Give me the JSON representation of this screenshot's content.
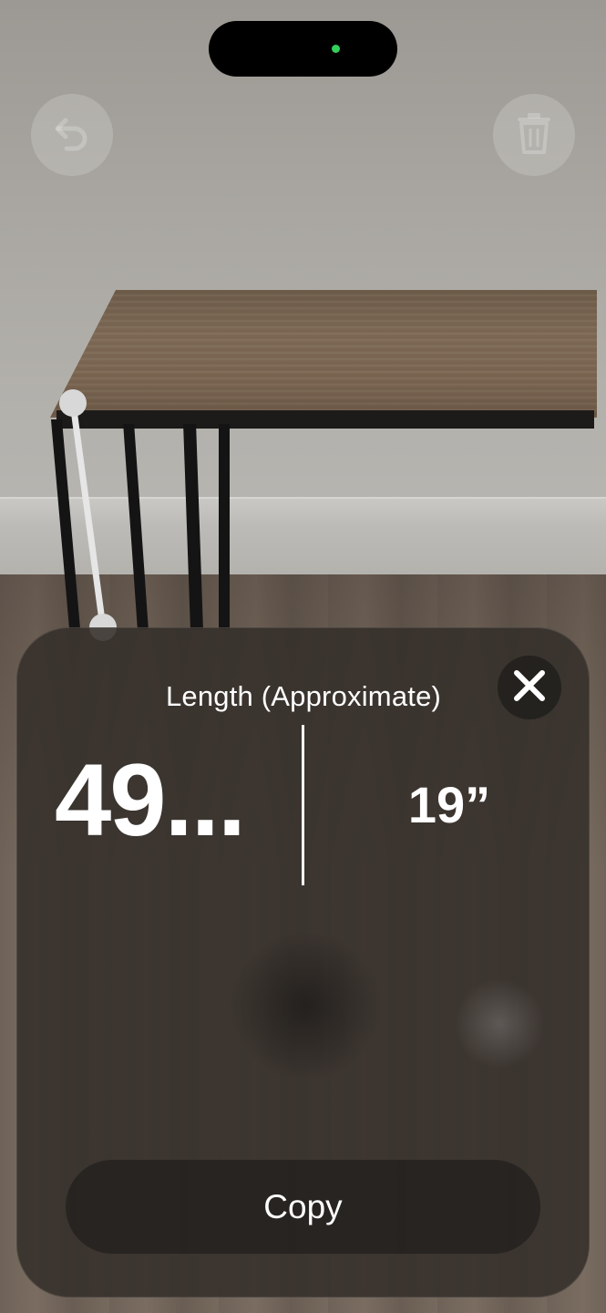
{
  "status_bar": {
    "camera_indicator_color": "#33d05c"
  },
  "toolbar": {
    "undo_icon": "undo-icon",
    "trash_icon": "trash-icon"
  },
  "result_panel": {
    "title": "Length (Approximate)",
    "close_icon": "close-icon",
    "primary_value": "49...",
    "secondary_value": "19”",
    "copy_label": "Copy"
  },
  "colors": {
    "panel_background": "#342f2a",
    "text": "#ffffff",
    "measure_line": "#e6e6e6"
  }
}
